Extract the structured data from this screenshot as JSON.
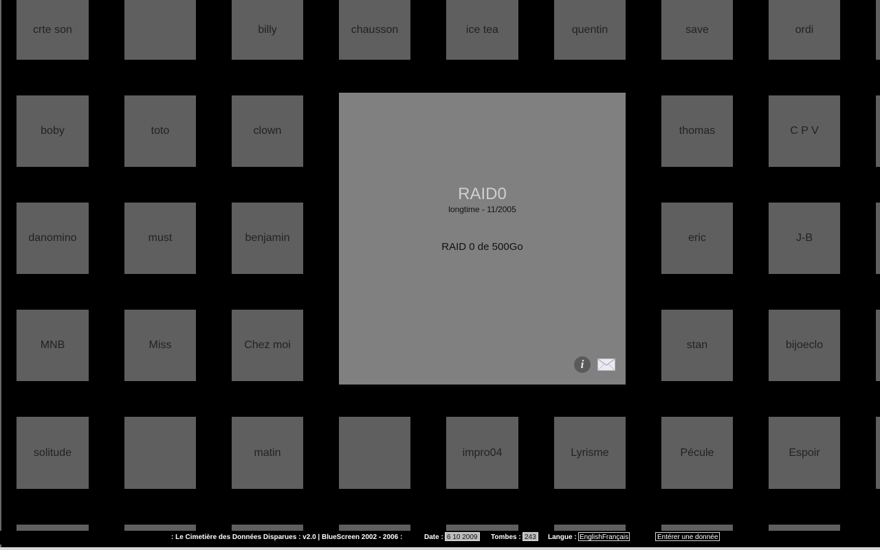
{
  "tiles": [
    "crte son",
    "",
    "billy",
    "chausson",
    "ice tea",
    "quentin",
    "save",
    "ordi",
    "boby",
    "toto",
    "clown",
    "thomas",
    "C P V",
    "danomino",
    "must",
    "benjamin",
    "eric",
    "J-B",
    "MNB",
    "Miss",
    "Chez moi",
    "stan",
    "bijoeclo",
    "solitude",
    "",
    "matin",
    "",
    "impro04",
    "Lyrisme",
    "Pécule",
    "Espoir"
  ],
  "detail": {
    "title": "RAID0",
    "subtitle": "longtime - 11/2005",
    "description": "RAID 0 de 500Go",
    "info_glyph": "i"
  },
  "footer": {
    "site_title": ": Le Cimetière des Données Disparues : v2.0 | BlueScreen 2002 - 2006 :",
    "date_label": "Date :",
    "date_value": "6 10 2009",
    "tombes_label": "Tombes :",
    "tombes_value": "243",
    "langue_label": "Langue :",
    "lang_english": "English",
    "lang_francais": "Français",
    "enter_button": "Entérer une donnée"
  },
  "icons": {
    "info": "info-icon",
    "mail": "envelope-icon"
  },
  "colors": {
    "background": "#000000",
    "tile": "#5f5f5f",
    "detail_panel": "#808080",
    "detail_title": "#cfcfcf"
  }
}
